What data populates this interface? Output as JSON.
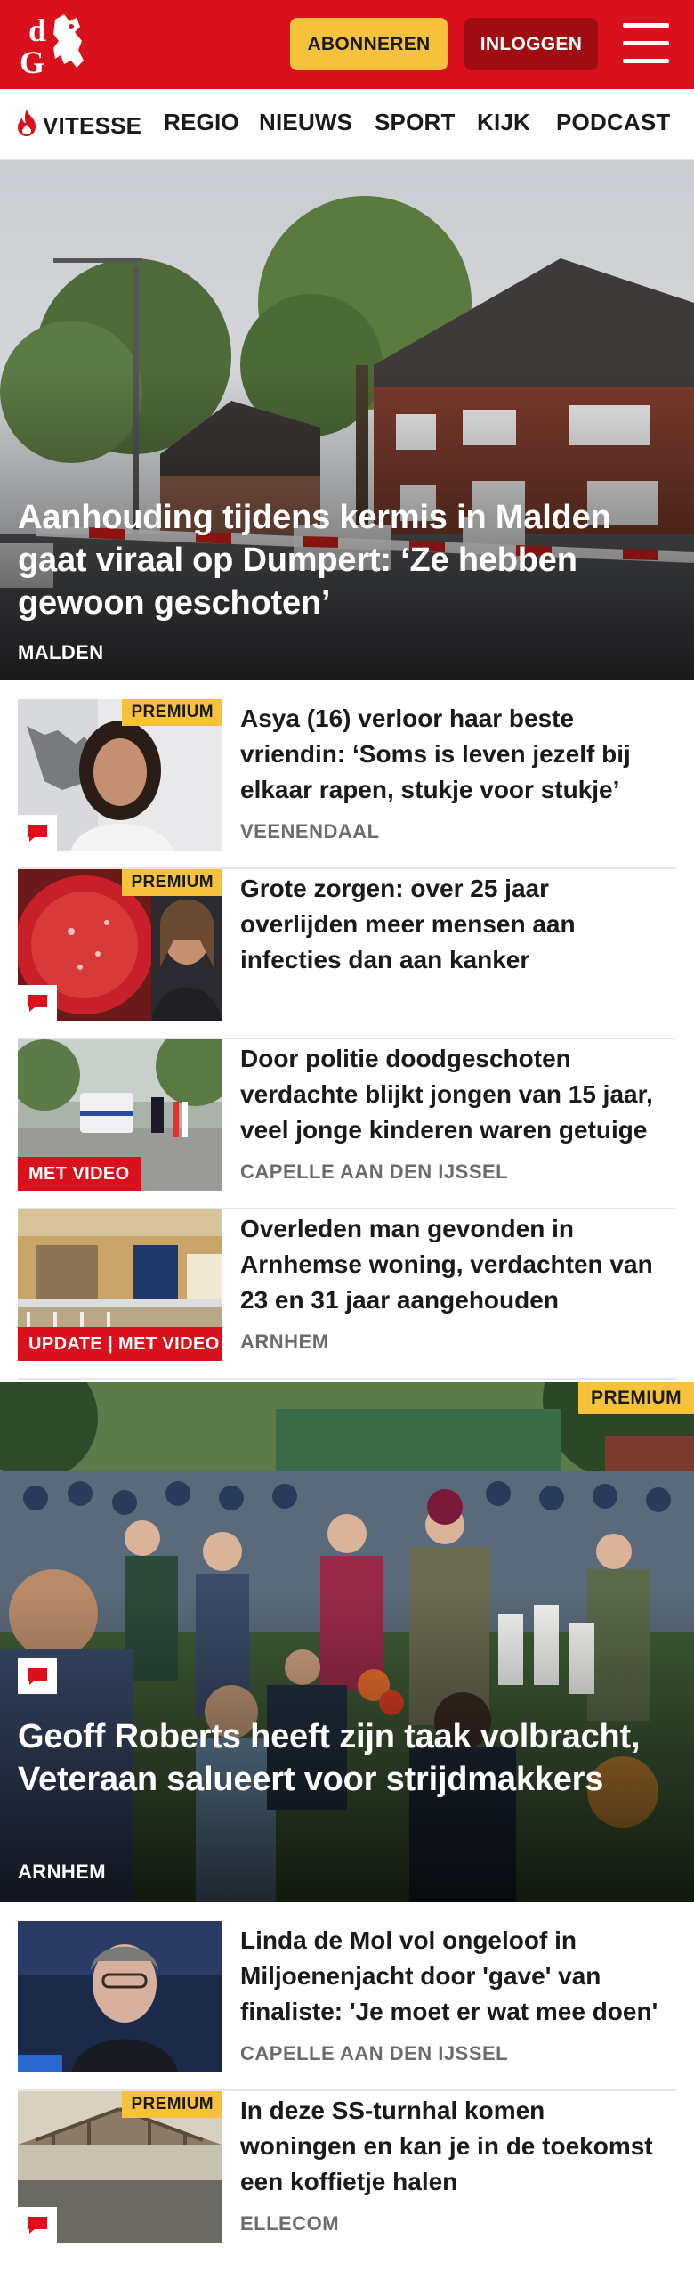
{
  "header": {
    "subscribe_label": "ABONNEREN",
    "login_label": "INLOGGEN",
    "logo_icon": "dg-logo-icon",
    "menu_icon": "hamburger-menu-icon",
    "brand_color": "#d8111c",
    "subscribe_color": "#f6c23b"
  },
  "nav": {
    "items": [
      {
        "label": "VITESSE",
        "icon": "flame-icon"
      },
      {
        "label": "REGIO"
      },
      {
        "label": "NIEUWS"
      },
      {
        "label": "SPORT"
      },
      {
        "label": "KIJK"
      },
      {
        "label": "PODCAST"
      }
    ]
  },
  "hero1": {
    "title": "Aanhouding tijdens kermis in Malden gaat viraal op Dumpert: ‘Ze hebben gewoon geschoten’",
    "location": "MALDEN"
  },
  "articles1": [
    {
      "title": "Asya (16) verloor haar beste vriendin: ‘Soms is leven jezelf bij elkaar rapen, stukje voor stukje’",
      "location": "VEENENDAAL",
      "premium": "PREMIUM",
      "comment_icon": "comment-icon"
    },
    {
      "title": "Grote zorgen: over 25 jaar overlijden meer mensen aan infecties dan aan kanker",
      "location": "",
      "premium": "PREMIUM",
      "comment_icon": "comment-icon"
    },
    {
      "title": "Door politie doodgeschoten verdachte blijkt jongen van 15 jaar, veel jonge kinderen waren getuige",
      "location": "CAPELLE AAN DEN IJSSEL",
      "tag": "MET VIDEO"
    },
    {
      "title": "Overleden man gevonden in Arnhemse woning, verdachten van 23 en 31 jaar aangehouden",
      "location": "ARNHEM",
      "tag": "UPDATE | MET VIDEO"
    }
  ],
  "hero2": {
    "title": "Geoff Roberts heeft zijn taak volbracht, Veteraan salueert voor strijdmakkers",
    "location": "ARNHEM",
    "premium": "PREMIUM",
    "comment_icon": "comment-icon"
  },
  "articles2": [
    {
      "title": "Linda de Mol vol ongeloof in Miljoenenjacht door 'gave' van finaliste: 'Je moet er wat mee doen'",
      "location": "CAPELLE AAN DEN IJSSEL"
    },
    {
      "title": "In deze SS-turnhal komen woningen en kan je in de toekomst een koffietje halen",
      "location": "ELLECOM",
      "premium": "PREMIUM",
      "comment_icon": "comment-icon"
    }
  ]
}
